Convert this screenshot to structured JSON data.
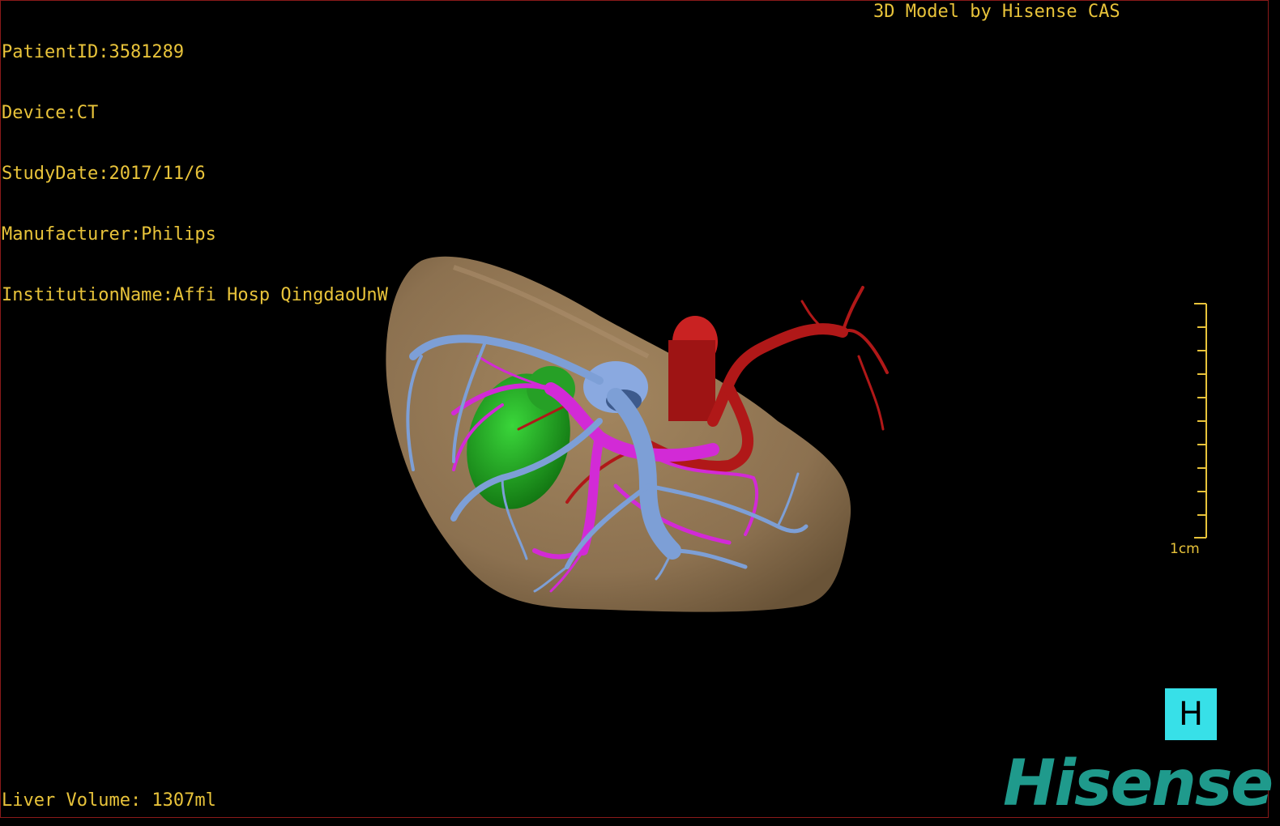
{
  "overlay": {
    "patient_id": "PatientID:3581289",
    "device": "Device:CT",
    "study_date": "StudyDate:2017/11/6",
    "manufacturer": "Manufacturer:Philips",
    "institution": "InstitutionName:Affi Hosp QingdaoUnW",
    "model_by": "3D Model by Hisense CAS",
    "liver_volume": "Liver Volume: 1307ml"
  },
  "scale_bar": {
    "label": "1cm"
  },
  "orientation": {
    "label": "H"
  },
  "logo": {
    "text": "Hisense"
  },
  "colors": {
    "overlay_text": "#e8c33a",
    "liver": "#8c7150",
    "portal_vein": "#7d9fd6",
    "hepatic_vein": "#d22ad6",
    "artery": "#b01818",
    "tumor": "#1fa11f",
    "orientation_cube": "#37e0e8",
    "logo": "#1f9a8c"
  }
}
